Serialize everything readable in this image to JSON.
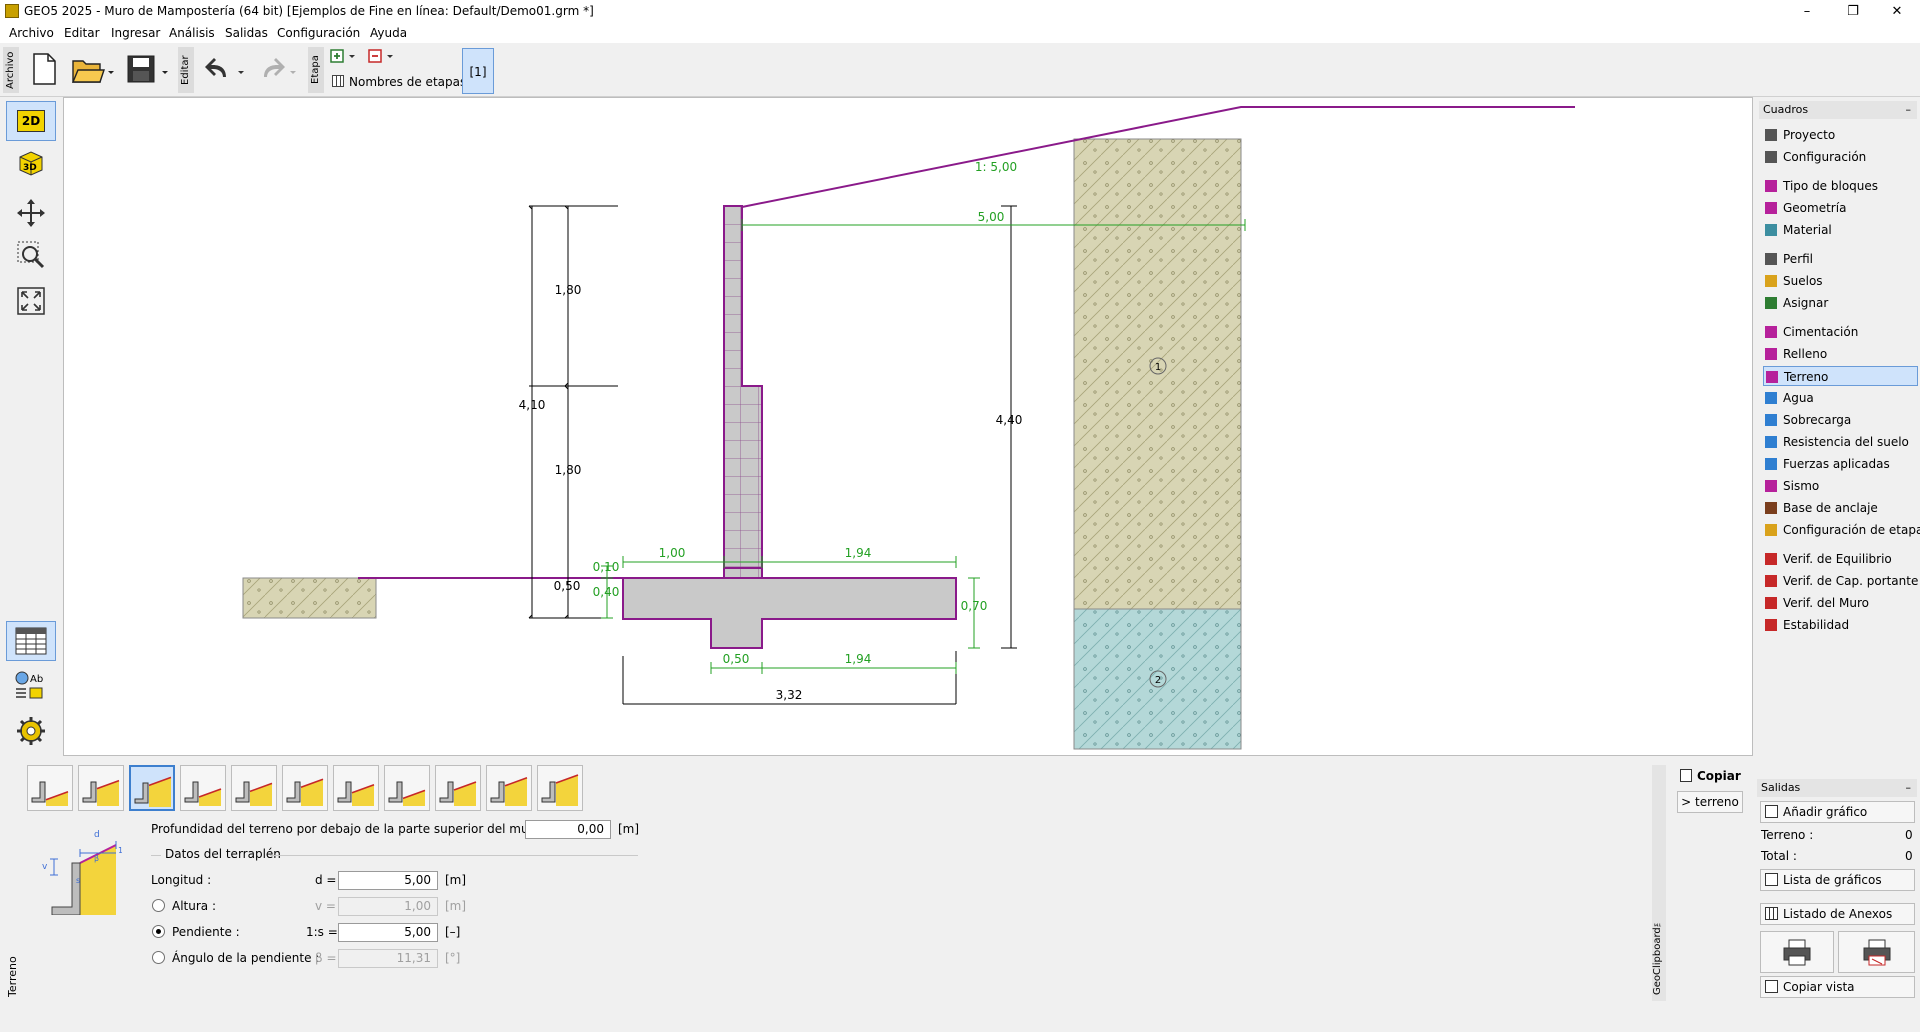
{
  "window": {
    "title": "GEO5 2025 - Muro de Mampostería (64 bit) [Ejemplos de Fine en línea: Default/Demo01.grm *]",
    "controls": [
      "–",
      "❐",
      "✕"
    ]
  },
  "menu": [
    "Archivo",
    "Editar",
    "Ingresar",
    "Análisis",
    "Salidas",
    "Configuración",
    "Ayuda"
  ],
  "toolbar": {
    "group_archivo": "Archivo",
    "group_editar": "Editar",
    "group_etapa": "Etapa",
    "stage_names_label": "Nombres de etapas",
    "stage_button": "[1]"
  },
  "left_tools": {
    "view2d": "2D",
    "view3d": "3D"
  },
  "drawing": {
    "slope_ratio": "1: 5,00",
    "dims": {
      "top_1_80": "1,80",
      "mid_1_80": "1,80",
      "total_4_10": "4,10",
      "base_0_50": "0,50",
      "d_0_10": "0,10",
      "d_0_40": "0,40",
      "toe_1_00": "1,00",
      "heel_1_94": "1,94",
      "footing_0_70": "0,70",
      "key_0_50": "0,50",
      "heel_1_94_b": "1,94",
      "base_3_32": "3,32",
      "slope_5_00": "5,00",
      "height_4_40": "4,40"
    },
    "soil_labels": [
      "1",
      "2"
    ]
  },
  "right_panel": {
    "header": "Cuadros",
    "collapse": "–",
    "items": [
      {
        "label": "Proyecto",
        "icon": "document-icon",
        "color": "#555555"
      },
      {
        "label": "Configuración",
        "icon": "gear-icon",
        "color": "#555555"
      },
      {
        "label": "Tipo de bloques",
        "icon": "blocks-icon",
        "color": "#b6219b"
      },
      {
        "label": "Geometría",
        "icon": "geometry-icon",
        "color": "#b6219b"
      },
      {
        "label": "Material",
        "icon": "material-icon",
        "color": "#3c8ea0"
      },
      {
        "label": "Perfil",
        "icon": "profile-icon",
        "color": "#555555"
      },
      {
        "label": "Suelos",
        "icon": "soils-icon",
        "color": "#d9a21b"
      },
      {
        "label": "Asignar",
        "icon": "assign-icon",
        "color": "#2e7d32"
      },
      {
        "label": "Cimentación",
        "icon": "foundation-icon",
        "color": "#b6219b"
      },
      {
        "label": "Relleno",
        "icon": "backfill-icon",
        "color": "#b6219b"
      },
      {
        "label": "Terreno",
        "icon": "terrain-icon",
        "color": "#b6219b"
      },
      {
        "label": "Agua",
        "icon": "water-icon",
        "color": "#2f7fd1"
      },
      {
        "label": "Sobrecarga",
        "icon": "surcharge-icon",
        "color": "#2f7fd1"
      },
      {
        "label": "Resistencia del suelo",
        "icon": "resistance-icon",
        "color": "#2f7fd1"
      },
      {
        "label": "Fuerzas aplicadas",
        "icon": "forces-icon",
        "color": "#2f7fd1"
      },
      {
        "label": "Sismo",
        "icon": "earthquake-icon",
        "color": "#b6219b"
      },
      {
        "label": "Base de anclaje",
        "icon": "anchor-icon",
        "color": "#7a3e1d"
      },
      {
        "label": "Configuración de etapa",
        "icon": "stage-config-icon",
        "color": "#d9a21b"
      },
      {
        "label": "Verif. de Equilibrio",
        "icon": "equilibrium-icon",
        "color": "#c62828"
      },
      {
        "label": "Verif. de Cap. portante",
        "icon": "bearing-icon",
        "color": "#c62828"
      },
      {
        "label": "Verif. del Muro",
        "icon": "wall-check-icon",
        "color": "#c62828"
      },
      {
        "label": "Estabilidad",
        "icon": "stability-icon",
        "color": "#c62828"
      }
    ],
    "selected": "Terreno"
  },
  "terrain_form": {
    "side_tab": "Terreno",
    "depth_label": "Profundidad del terreno por debajo de la parte superior del muro : h =",
    "depth_value": "0,00",
    "depth_unit": "[m]",
    "group_title": "Datos del terraplén",
    "length_label": "Longitud :",
    "length_sym": "d =",
    "length_value": "5,00",
    "length_unit": "[m]",
    "height_label": "Altura :",
    "height_sym": "v =",
    "height_value": "1,00",
    "height_unit": "[m]",
    "slope_label": "Pendiente :",
    "slope_sym": "1:s =",
    "slope_value": "5,00",
    "slope_unit": "[–]",
    "angle_label": "Ángulo de la pendiente :",
    "angle_sym": "β =",
    "angle_value": "11,31",
    "angle_unit": "[°]",
    "selected_option": "Pendiente",
    "terrain_types_count": 11,
    "selected_type_index": 2
  },
  "clipboard": {
    "copy_label": "Copiar",
    "terreno_btn": "> terreno",
    "side_label": "GeoClipboard™"
  },
  "outputs": {
    "header": "Salidas",
    "collapse": "–",
    "add_graphic": "Añadir gráfico",
    "terreno_label": "Terreno :",
    "terreno_count": "0",
    "total_label": "Total :",
    "total_count": "0",
    "graphics_list": "Lista de gráficos",
    "annex_list": "Listado de Anexos",
    "copy_view": "Copiar vista"
  }
}
